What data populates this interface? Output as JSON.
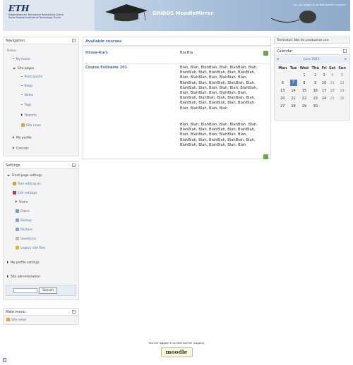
{
  "header": {
    "logo_text": "ETH",
    "logo_line1": "Eidgenössische Technische Hochschule Zürich",
    "logo_line2": "Swiss Federal Institute of Technology Zurich",
    "site_name": "GRiDDS MoodleMirror",
    "login_text": "You are logged in as Willi Kernen (Logout)"
  },
  "navigation": {
    "title": "Navigation",
    "home": "Home",
    "my_home": "My home",
    "site_pages": "Site pages",
    "participants": "Participants",
    "blogs": "Blogs",
    "notes": "Notes",
    "tags": "Tags",
    "reports": "Reports",
    "site_news": "Site news",
    "my_profile": "My profile",
    "courses": "Courses"
  },
  "settings": {
    "title": "Settings",
    "front_page_settings": "Front page settings",
    "turn_editing_on": "Turn editing on",
    "edit_settings": "Edit settings",
    "users": "Users",
    "filters": "Filters",
    "backup": "Backup",
    "restore": "Restore",
    "questions": "Questions",
    "legacy_site_files": "Legacy site files",
    "my_profile_settings": "My profile settings",
    "site_administration": "Site administration",
    "search_button": "Search"
  },
  "main_menu": {
    "title": "Main menu",
    "site_news": "Site news"
  },
  "available_courses": {
    "title": "Available courses",
    "courses": [
      {
        "name": "Hossa-Kurs",
        "summary": "Bla Bla"
      },
      {
        "name": "Course Fullname 101",
        "summary_p1": "Blah, Blah, BlahBlah, Blah, BlahBlah. Blah, BlahBlah, Blah, BlahBlah, Blah, BlahBlah, Blah, BlahBlah, Blah, BlahBlah. Blah, BlahBlah, Blah, BlahBlah, BlahBlah, Blah, BlahBlah, Blah, Blah, Blah, Blah, BlahBlah, Blah, BlahBlah. Blah, BlahBlah, Blah, BlahBlah, BlahBlah, Blah, BlahBlah, Blah, BlahBlah, Blah, BlahBlah, Blah, BlahBlah. Blah, BlahBlah, Blah, Blah",
        "summary_p2": "Blah, Blah, BlahBlah, Blah, BlahBlah. Blah, BlahBlah, Blah, BlahBlah, Blah, BlahBlah, Blah, BlahBlah, Blah, BlahBlah. Blah, BlahBlah, Blah, BlahBlah, BlahBlah, Blah, BlahBlah, Blah, BlahBlah, Blah, Blah"
      }
    ]
  },
  "test_notice": "Testinstall. Not for productive use",
  "calendar": {
    "title": "Calendar",
    "month": "June 2011",
    "weekdays": [
      "Mon",
      "Tue",
      "Wed",
      "Thu",
      "Fri",
      "Sat",
      "Sun"
    ],
    "weeks": [
      [
        "",
        "",
        "1",
        "2",
        "3",
        "4",
        "5"
      ],
      [
        "6",
        "7",
        "8",
        "9",
        "10",
        "11",
        "12"
      ],
      [
        "13",
        "14",
        "15",
        "16",
        "17",
        "18",
        "19"
      ],
      [
        "20",
        "21",
        "22",
        "23",
        "24",
        "25",
        "26"
      ],
      [
        "27",
        "28",
        "29",
        "30",
        "",
        "",
        ""
      ]
    ],
    "today": "7"
  },
  "footer": {
    "login_text": "You are logged in as Willi Kernen (Logout)",
    "logo": "moodle"
  },
  "colors": {
    "link": "#4a6fa5",
    "today": "#5c77b8",
    "header_bg": "#a9c0da"
  }
}
